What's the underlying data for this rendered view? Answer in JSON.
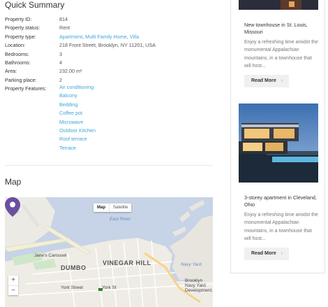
{
  "quick_summary": {
    "title": "Quick Summary",
    "rows": [
      {
        "label": "Property ID:",
        "value": "814"
      },
      {
        "label": "Property status:",
        "value": "Rent"
      },
      {
        "label": "Property type:",
        "links": [
          "Apartment",
          "Multi Family Home",
          "Villa"
        ]
      },
      {
        "label": "Location:",
        "value": "218 Front Street, Brooklyn, NY 11201, USA"
      },
      {
        "label": "Bedrooms:",
        "value": "3"
      },
      {
        "label": "Bathrooms:",
        "value": "4"
      },
      {
        "label": "Area:",
        "value": "232.00 m²"
      },
      {
        "label": "Parking place:",
        "value": "2"
      },
      {
        "label": "Property Features:",
        "value": ""
      }
    ],
    "features": [
      "Air conditioning",
      "Balcony",
      "Bedding",
      "Coffee pot",
      "Microwave",
      "Outdoor Kitchen",
      "Roof terrace",
      "Terrace"
    ]
  },
  "map": {
    "title": "Map",
    "toggle": {
      "map": "Map",
      "satellite": "Satellite"
    },
    "zoom_in": "+",
    "zoom_out": "−",
    "labels": {
      "east_river": "East River",
      "jane_carousel": "Jane's Carousel",
      "dumbo": "DUMBO",
      "vinegar_hill": "VINEGAR HILL",
      "brooklyn_navy_yard": "Brooklyn Navy Yard Development...",
      "york_street": "York Street",
      "york_st": "York St",
      "navy_yard": "Navy Yard"
    }
  },
  "sidebar": {
    "cards": [
      {
        "title": "New townhouse in St. Louis, Missouri",
        "description": "Enjoy a refreshing time amidst the monumental Appalachian mountains, in a townhouse that will host...",
        "button": "Read More",
        "chevron": "›"
      },
      {
        "title": "3-storey apartment in Cleveland, Ohio",
        "description": "Enjoy a refreshing time amidst the monumental Appalachian mountains, in a townhouse that will host...",
        "button": "Read More",
        "chevron": "›"
      }
    ]
  },
  "colors": {
    "link": "#3fa7d6",
    "pin": "#6b4fa0",
    "water": "#c7d3e6"
  }
}
